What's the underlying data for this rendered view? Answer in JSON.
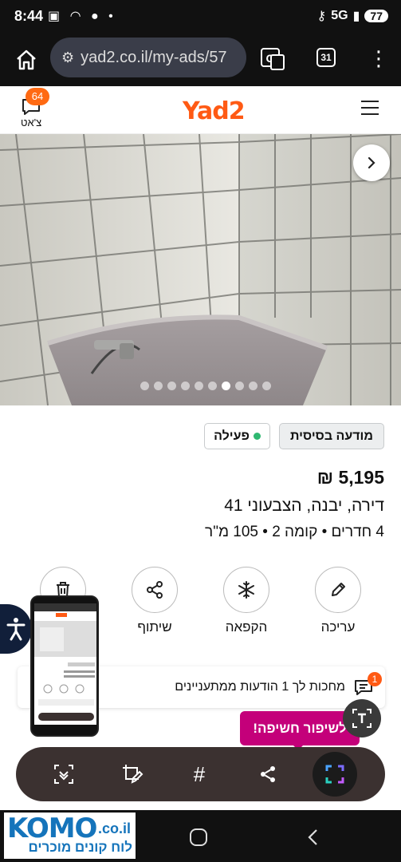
{
  "status_bar": {
    "time": "8:44",
    "network": "5G",
    "battery": "77"
  },
  "browser": {
    "url": "yad2.co.il/my-ads/57",
    "tab_count": "31"
  },
  "site_header": {
    "logo": "Yad2",
    "chat_label": "צ'אט",
    "chat_count": "64"
  },
  "gallery": {
    "total_images": 10,
    "active_index": 6
  },
  "listing": {
    "tag_basic": "מודעה בסיסית",
    "tag_status": "פעילה",
    "price": "5,195 ₪",
    "address": "דירה, יבנה, הצבעוני 41",
    "details": "4 חדרים  •  קומה 2  •  105 מ\"ר"
  },
  "actions": {
    "edit": "עריכה",
    "freeze": "הקפאה",
    "share": "שיתוף"
  },
  "notification": {
    "text": "מחכות לך 1 הודעות ממתעניינים",
    "badge": "1"
  },
  "tooltip": {
    "improve": "לשיפור חשיפה!"
  },
  "toolbar": {
    "hashtag": "#"
  },
  "watermark": {
    "brand": "KOMO",
    "domain": ".co.il",
    "tagline": "לוח קונים מוכרים"
  },
  "colors": {
    "brand_orange": "#ff5a14",
    "active_green": "#2fb871",
    "promo_magenta": "#c4007a"
  }
}
